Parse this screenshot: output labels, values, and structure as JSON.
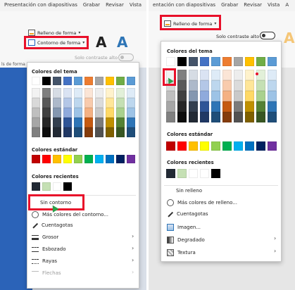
{
  "left": {
    "tabs": [
      "Presentación con diapositivas",
      "Grabar",
      "Revisar",
      "Vista"
    ],
    "relleno_label": "Relleno de forma",
    "contorno_label": "Contorno de forma",
    "high_contrast_label": "Solo contraste alto",
    "left_edge_label": "ls de forma",
    "theme_title": "Colores del tema",
    "standard_title": "Colores estándar",
    "recent_title": "Colores recientes",
    "menu": {
      "no_outline": "Sin contorno",
      "more_colors": "Más colores del contorno...",
      "eyedropper": "Cuentagotas",
      "weight": "Grosor",
      "sketched": "Esbozado",
      "dashes": "Rayas",
      "arrows": "Flechas"
    }
  },
  "right": {
    "tabs": [
      "entación con diapositivas",
      "Grabar",
      "Revisar",
      "Vista",
      "A"
    ],
    "relleno_label": "Relleno de forma",
    "high_contrast_label": "Solo contraste alto",
    "theme_title": "Colores del tema",
    "standard_title": "Colores estándar",
    "recent_title": "Colores recientes",
    "menu": {
      "no_fill": "Sin relleno",
      "more_colors": "Más colores de relleno...",
      "eyedropper": "Cuentagotas",
      "image": "Imagen...",
      "gradient": "Degradado",
      "texture": "Textura"
    }
  },
  "theme_colors": [
    "#ffffff",
    "#000000",
    "#44546a",
    "#4472c4",
    "#5b9bd5",
    "#ed7d31",
    "#a5a5a5",
    "#ffc000",
    "#70ad47",
    "#5b9bd5"
  ],
  "theme_shades": [
    [
      "#f2f2f2",
      "#d9d9d9",
      "#bfbfbf",
      "#a6a6a6",
      "#808080"
    ],
    [
      "#7f7f7f",
      "#595959",
      "#404040",
      "#262626",
      "#0d0d0d"
    ],
    [
      "#d6dce4",
      "#adb9ca",
      "#8497b0",
      "#333f4f",
      "#222a35"
    ],
    [
      "#dae3f3",
      "#b4c7e7",
      "#8faadc",
      "#2f5597",
      "#203864"
    ],
    [
      "#deebf7",
      "#bdd7ee",
      "#9dc3e6",
      "#2e75b6",
      "#1f4e79"
    ],
    [
      "#fbe5d6",
      "#f8cbad",
      "#f4b183",
      "#c55a11",
      "#843c0c"
    ],
    [
      "#ededed",
      "#dbdbdb",
      "#c9c9c9",
      "#7b7b7b",
      "#525252"
    ],
    [
      "#fff2cc",
      "#ffe699",
      "#ffd966",
      "#bf9000",
      "#7f6000"
    ],
    [
      "#e2f0d9",
      "#c5e0b4",
      "#a9d18e",
      "#548235",
      "#385723"
    ],
    [
      "#deebf7",
      "#bdd7ee",
      "#9dc3e6",
      "#2e75b6",
      "#1f4e79"
    ]
  ],
  "standard_colors": [
    "#c00000",
    "#ff0000",
    "#ffc000",
    "#ffff00",
    "#92d050",
    "#00b050",
    "#00b0f0",
    "#0070c0",
    "#002060",
    "#7030a0"
  ],
  "recent_left": [
    "#222a35",
    "#c5e0b4",
    "#ffffff",
    "#000000"
  ],
  "recent_right": [
    "#222a35",
    "#c5e0b4",
    "#ffffff",
    "#ffffff",
    "#000000"
  ],
  "accent": "#e8102a"
}
